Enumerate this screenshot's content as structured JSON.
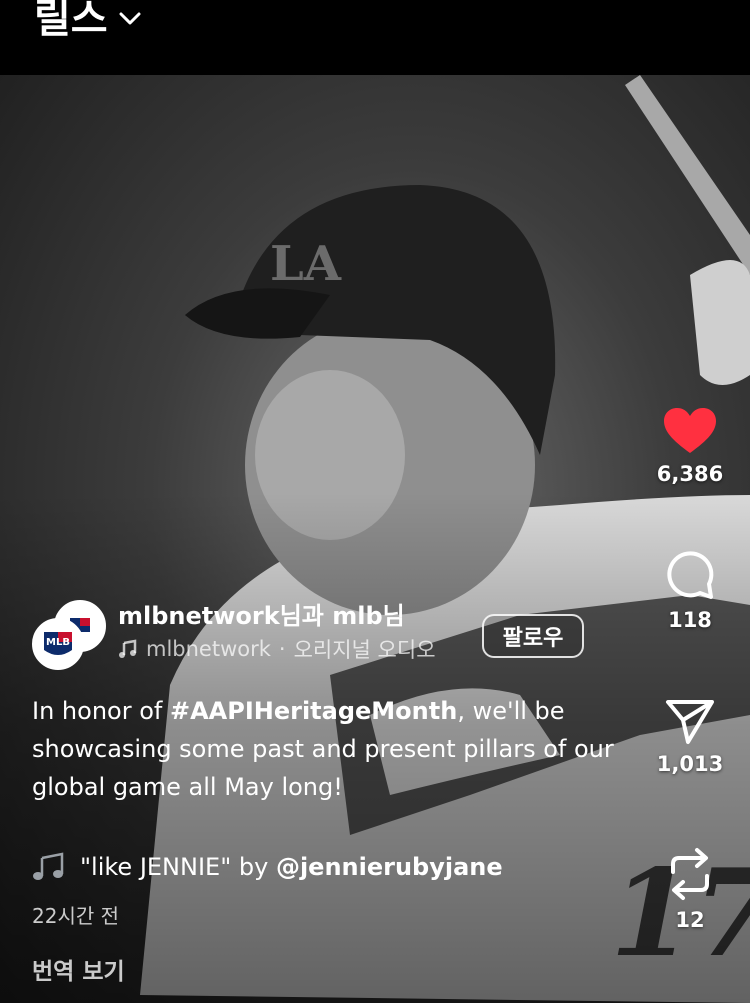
{
  "header": {
    "title": "릴스"
  },
  "actions": {
    "likes": "6,386",
    "comments": "118",
    "shares": "1,013",
    "remixes": "12",
    "like_color": "#ff3040"
  },
  "author": {
    "names_primary": "mlbnetwork",
    "names_joiner": "님과 ",
    "names_secondary": "mlb",
    "names_suffix": "님",
    "audio_source": "mlbnetwork",
    "audio_sep": " · ",
    "audio_label": "오리지널 오디오",
    "follow_label": "팔로우",
    "avatar_logo": "MLB"
  },
  "caption": {
    "prefix": "In honor of ",
    "hashtag": "#AAPIHeritageMonth",
    "suffix": ", we'll be showcasing some past and present pillars of our global game all May long!"
  },
  "music": {
    "icon": "music-notes-icon",
    "title": "\"like JENNIE\" by ",
    "handle": "@jennierubyjane"
  },
  "meta": {
    "time_ago": "22시간 전",
    "translate_label": "번역 보기"
  },
  "video": {
    "jersey_number": "17"
  }
}
